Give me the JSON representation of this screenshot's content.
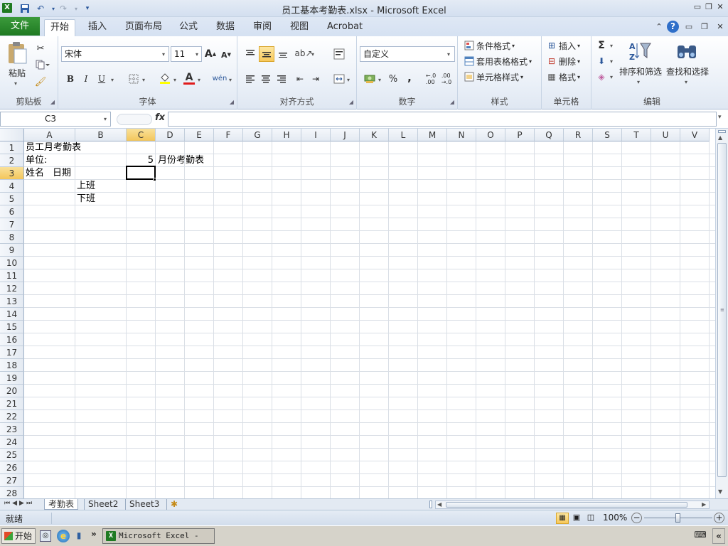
{
  "window": {
    "title": "员工基本考勤表.xlsx - Microsoft Excel"
  },
  "ribbon": {
    "file_tab": "文件",
    "tabs": [
      "开始",
      "插入",
      "页面布局",
      "公式",
      "数据",
      "审阅",
      "视图",
      "Acrobat"
    ],
    "active_tab": "开始",
    "clipboard": {
      "paste": "粘贴",
      "label": "剪贴板"
    },
    "font": {
      "name": "宋体",
      "size": "11",
      "label": "字体",
      "bold": "B",
      "italic": "I",
      "underline": "U",
      "grow": "A",
      "shrink": "A"
    },
    "alignment": {
      "label": "对齐方式"
    },
    "number": {
      "format": "自定义",
      "label": "数字",
      "percent": "%",
      "comma": ","
    },
    "styles": {
      "conditional": "条件格式",
      "table": "套用表格格式",
      "cell": "单元格样式",
      "label": "样式"
    },
    "cells": {
      "insert": "插入",
      "delete": "删除",
      "format": "格式",
      "label": "单元格"
    },
    "editing": {
      "sum": "Σ",
      "sort": "排序和筛选",
      "find": "查找和选择",
      "label": "编辑"
    }
  },
  "formula_bar": {
    "name_box": "C3",
    "fx": "fx",
    "formula": ""
  },
  "sheet": {
    "columns": [
      "A",
      "B",
      "C",
      "D",
      "E",
      "F",
      "G",
      "H",
      "I",
      "J",
      "K",
      "L",
      "M",
      "N",
      "O",
      "P",
      "Q",
      "R",
      "S",
      "T",
      "U",
      "V"
    ],
    "rows": [
      "1",
      "2",
      "3",
      "4",
      "5",
      "6",
      "7",
      "8",
      "9",
      "10",
      "11",
      "12",
      "13",
      "14",
      "15",
      "16",
      "17",
      "18",
      "19",
      "20",
      "21",
      "22",
      "23",
      "24",
      "25",
      "26",
      "27",
      "28"
    ],
    "selected_column": "C",
    "selected_row": "3",
    "cells": {
      "A1": "员工月考勤表",
      "A2": "单位:",
      "C2": "5",
      "D2": "月份考勤表",
      "A3": "姓名",
      "A3b": "日期",
      "B4": "上班",
      "B5": "下班"
    }
  },
  "sheet_tabs": [
    "考勤表",
    "Sheet2",
    "Sheet3"
  ],
  "status": {
    "ready": "就绪",
    "zoom": "100%"
  },
  "taskbar": {
    "start": "开始",
    "excel_task": "Microsoft Excel - ..."
  }
}
